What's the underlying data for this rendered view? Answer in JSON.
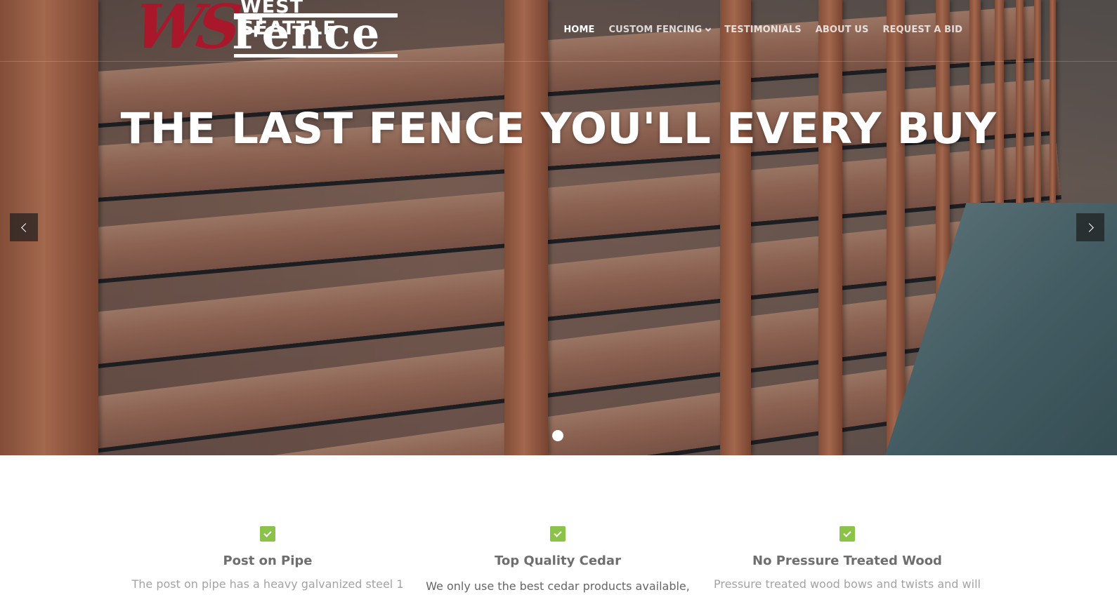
{
  "logo": {
    "monogram": "WS",
    "top_text": "WEST SEATTLE",
    "main_text": "Fence"
  },
  "nav": {
    "items": [
      {
        "label": "HOME",
        "active": true
      },
      {
        "label": "CUSTOM FENCING",
        "has_dropdown": true
      },
      {
        "label": "TESTIMONIALS"
      },
      {
        "label": "ABOUT US"
      },
      {
        "label": "REQUEST A BID"
      }
    ]
  },
  "hero": {
    "title": "THE LAST FENCE YOU'LL EVERY BUY",
    "slide_count": 1,
    "active_slide": 1
  },
  "features": [
    {
      "icon": "checkbox-checked-icon",
      "title": "Post on Pipe",
      "text": "The post on pipe has a heavy galvanized steel 1"
    },
    {
      "icon": "checkbox-checked-icon",
      "title": "Top Quality Cedar",
      "text": "We only use the best cedar products available,"
    },
    {
      "icon": "checkbox-checked-icon",
      "title": "No Pressure Treated Wood",
      "text": "Pressure treated wood bows and twists and will"
    }
  ],
  "colors": {
    "brand_red": "#a8182a",
    "check_green": "#8bc34a",
    "heading_gray": "#6e6e6e",
    "body_gray": "#a3a3a3"
  }
}
